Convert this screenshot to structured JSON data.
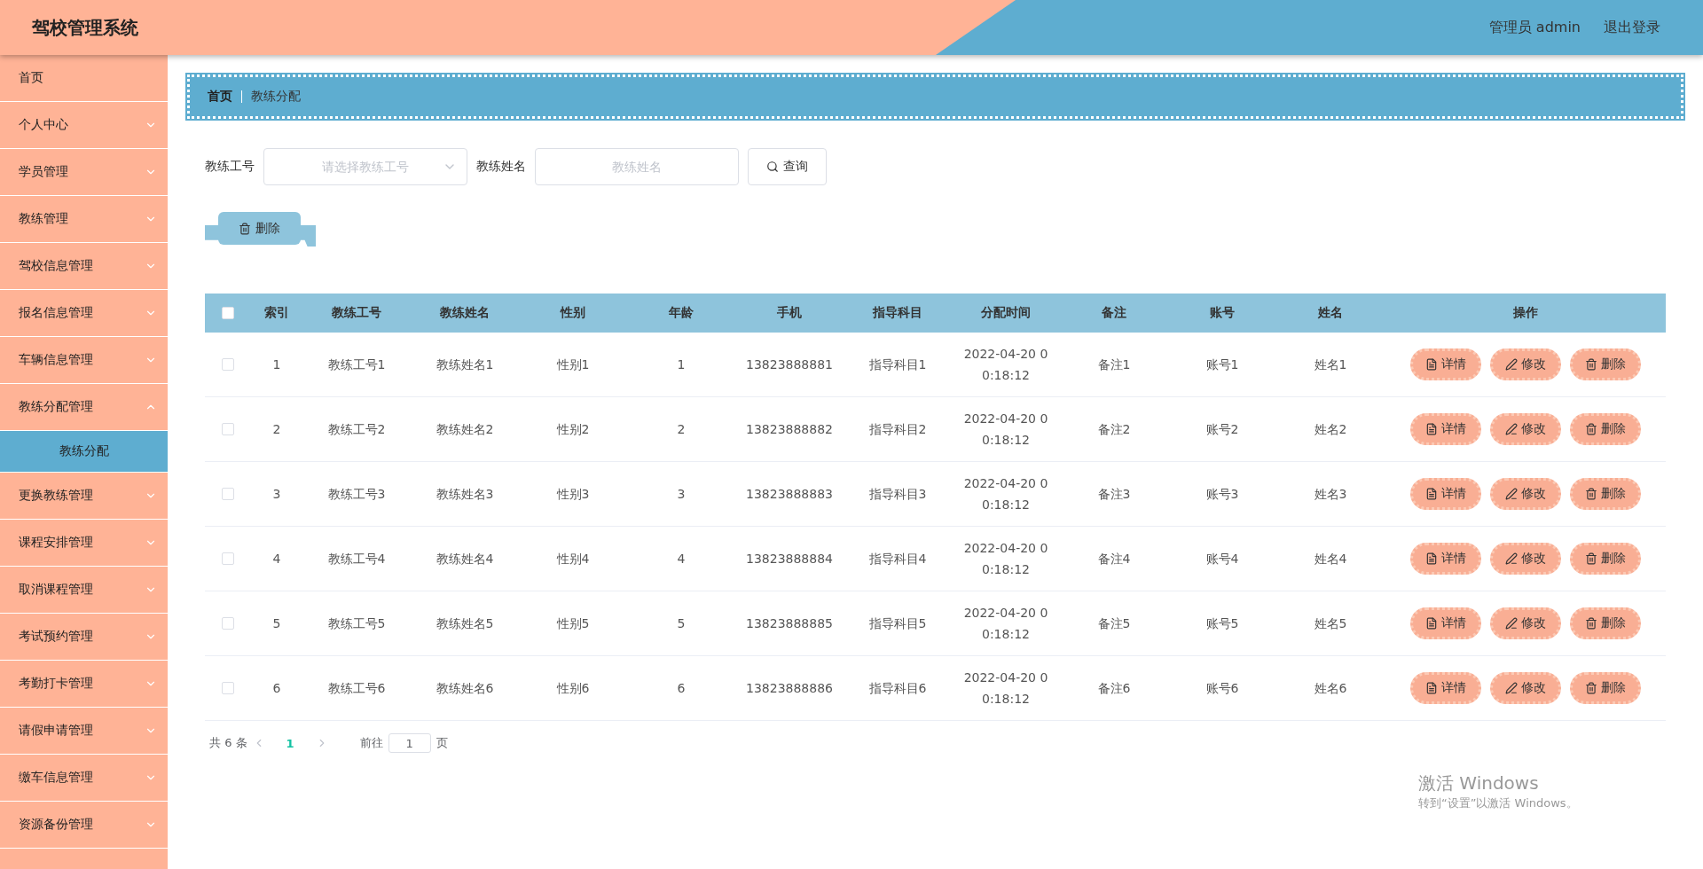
{
  "header": {
    "title": "驾校管理系统",
    "user": "管理员 admin",
    "logout": "退出登录"
  },
  "sidebar": {
    "items": [
      {
        "label": "首页",
        "kind": "link"
      },
      {
        "label": "个人中心",
        "kind": "menu",
        "expanded": false
      },
      {
        "label": "学员管理",
        "kind": "menu",
        "expanded": false
      },
      {
        "label": "教练管理",
        "kind": "menu",
        "expanded": false
      },
      {
        "label": "驾校信息管理",
        "kind": "menu",
        "expanded": false
      },
      {
        "label": "报名信息管理",
        "kind": "menu",
        "expanded": false
      },
      {
        "label": "车辆信息管理",
        "kind": "menu",
        "expanded": false
      },
      {
        "label": "教练分配管理",
        "kind": "menu",
        "expanded": true,
        "children": [
          {
            "label": "教练分配",
            "selected": true
          }
        ]
      },
      {
        "label": "更换教练管理",
        "kind": "menu",
        "expanded": false
      },
      {
        "label": "课程安排管理",
        "kind": "menu",
        "expanded": false
      },
      {
        "label": "取消课程管理",
        "kind": "menu",
        "expanded": false
      },
      {
        "label": "考试预约管理",
        "kind": "menu",
        "expanded": false
      },
      {
        "label": "考勤打卡管理",
        "kind": "menu",
        "expanded": false
      },
      {
        "label": "请假申请管理",
        "kind": "menu",
        "expanded": false
      },
      {
        "label": "缴车信息管理",
        "kind": "menu",
        "expanded": false
      },
      {
        "label": "资源备份管理",
        "kind": "menu",
        "expanded": false
      }
    ]
  },
  "breadcrumb": [
    "首页",
    "教练分配"
  ],
  "search": {
    "fields": [
      {
        "label": "教练工号",
        "kind": "select",
        "placeholder": "请选择教练工号"
      },
      {
        "label": "教练姓名",
        "kind": "input",
        "placeholder": "教练姓名"
      }
    ],
    "button": "查询"
  },
  "toolbar": {
    "delete": "删除"
  },
  "table": {
    "columns": [
      "索引",
      "教练工号",
      "教练姓名",
      "性别",
      "年龄",
      "手机",
      "指导科目",
      "分配时间",
      "备注",
      "账号",
      "姓名",
      "操作"
    ],
    "all_checked": false,
    "rows": [
      {
        "checked": false,
        "cells": [
          "1",
          "教练工号1",
          "教练姓名1",
          "性别1",
          "1",
          "13823888881",
          "指导科目1",
          "2022-04-20 0\n0:18:12",
          "备注1",
          "账号1",
          "姓名1"
        ],
        "actions": [
          "详情",
          "修改",
          "删除"
        ]
      },
      {
        "checked": false,
        "cells": [
          "2",
          "教练工号2",
          "教练姓名2",
          "性别2",
          "2",
          "13823888882",
          "指导科目2",
          "2022-04-20 0\n0:18:12",
          "备注2",
          "账号2",
          "姓名2"
        ],
        "actions": [
          "详情",
          "修改",
          "删除"
        ]
      },
      {
        "checked": false,
        "cells": [
          "3",
          "教练工号3",
          "教练姓名3",
          "性别3",
          "3",
          "13823888883",
          "指导科目3",
          "2022-04-20 0\n0:18:12",
          "备注3",
          "账号3",
          "姓名3"
        ],
        "actions": [
          "详情",
          "修改",
          "删除"
        ]
      },
      {
        "checked": false,
        "cells": [
          "4",
          "教练工号4",
          "教练姓名4",
          "性别4",
          "4",
          "13823888884",
          "指导科目4",
          "2022-04-20 0\n0:18:12",
          "备注4",
          "账号4",
          "姓名4"
        ],
        "actions": [
          "详情",
          "修改",
          "删除"
        ]
      },
      {
        "checked": false,
        "cells": [
          "5",
          "教练工号5",
          "教练姓名5",
          "性别5",
          "5",
          "13823888885",
          "指导科目5",
          "2022-04-20 0\n0:18:12",
          "备注5",
          "账号5",
          "姓名5"
        ],
        "actions": [
          "详情",
          "修改",
          "删除"
        ]
      },
      {
        "checked": false,
        "cells": [
          "6",
          "教练工号6",
          "教练姓名6",
          "性别6",
          "6",
          "13823888886",
          "指导科目6",
          "2022-04-20 0\n0:18:12",
          "备注6",
          "账号6",
          "姓名6"
        ],
        "actions": [
          "详情",
          "修改",
          "删除"
        ]
      }
    ]
  },
  "pagination": {
    "total": "共 6 条",
    "pages": [
      {
        "label": "1",
        "selected": true
      }
    ],
    "goto": "前往",
    "page_value": "1",
    "page_unit": "页"
  },
  "os_notice": {
    "title": "激活 Windows",
    "text": "转到“设置”以激活 Windows。"
  }
}
